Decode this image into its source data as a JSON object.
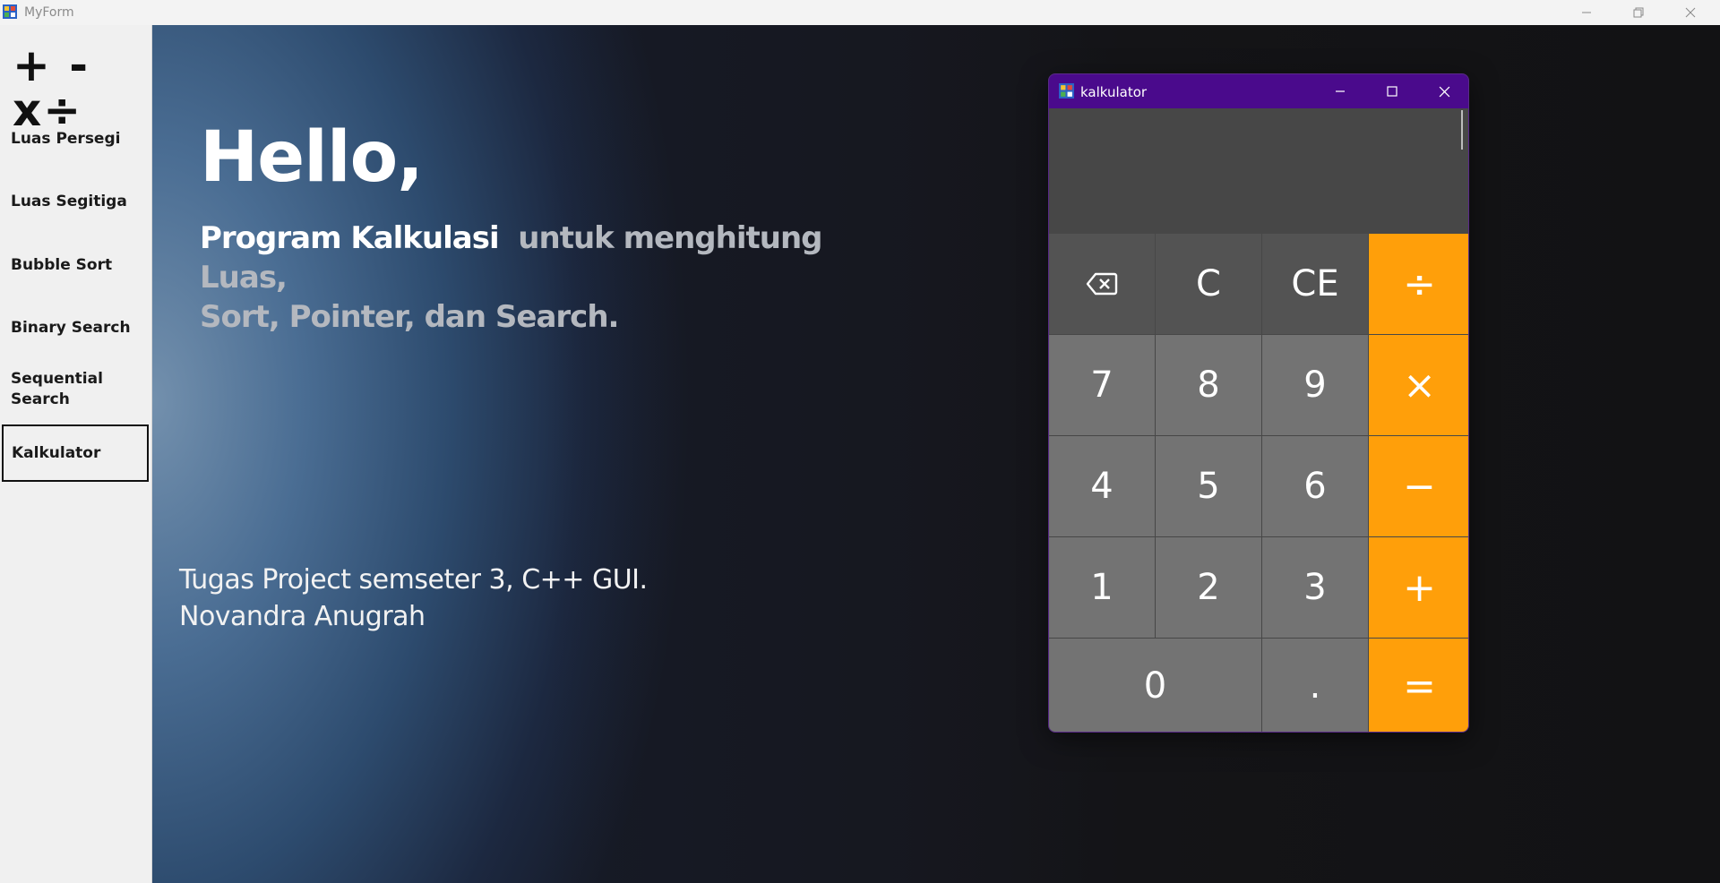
{
  "window": {
    "title": "MyForm"
  },
  "sidebar": {
    "logo": "+ - x÷",
    "items": [
      {
        "label": "Luas Persegi"
      },
      {
        "label": "Luas Segitiga"
      },
      {
        "label": "Bubble Sort"
      },
      {
        "label": "Binary Search"
      },
      {
        "label": "Sequential Search"
      },
      {
        "label": "Kalkulator",
        "active": true
      }
    ]
  },
  "main": {
    "greeting": "Hello,",
    "subtitle_strong": "Program Kalkulasi",
    "subtitle_soft_1": "untuk menghitung Luas,",
    "subtitle_soft_2": "Sort, Pointer, dan Search.",
    "footer_line1": "Tugas Project semseter 3, C++ GUI.",
    "footer_line2": "Novandra Anugrah"
  },
  "calculator": {
    "title": "kalkulator",
    "display": "",
    "keys": {
      "backspace": "⌫",
      "clear": "C",
      "clear_entry": "CE",
      "divide": "÷",
      "seven": "7",
      "eight": "8",
      "nine": "9",
      "multiply": "×",
      "four": "4",
      "five": "5",
      "six": "6",
      "minus": "−",
      "one": "1",
      "two": "2",
      "three": "3",
      "plus": "+",
      "zero": "0",
      "dot": ".",
      "equals": "="
    }
  },
  "colors": {
    "calc_title_bar": "#4a0a8c",
    "operator_key": "#ff9f0a",
    "function_key": "#535353",
    "digit_key": "#737373"
  },
  "icons": {
    "app": "app-icon",
    "minimize": "minimize-icon",
    "maximize": "maximize-icon",
    "close": "close-icon",
    "backspace": "backspace-icon"
  }
}
